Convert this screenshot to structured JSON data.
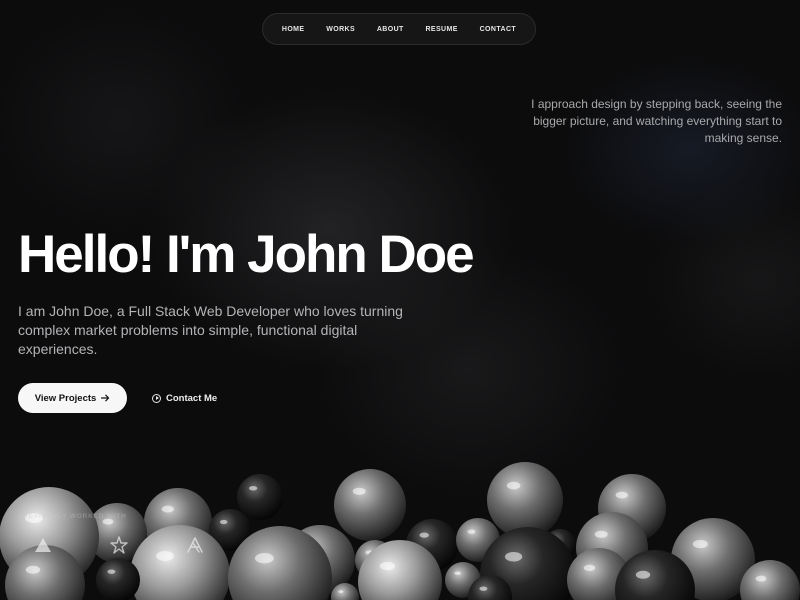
{
  "nav": {
    "items": [
      "HOME",
      "WORKS",
      "ABOUT",
      "RESUME",
      "CONTACT"
    ]
  },
  "tagline": "I approach design by stepping back, seeing the bigger picture, and watching everything start to making sense.",
  "hero": {
    "title": "Hello! I'm John Doe",
    "description": "I am John Doe, a Full Stack Web Developer who loves turning complex market problems into simple, functional digital experiences."
  },
  "buttons": {
    "primary_label": "View Projects",
    "primary_icon": "arrow-right-icon",
    "secondary_label": "Contact Me",
    "secondary_icon": "play-circle-icon"
  },
  "worked_with": {
    "label": "PREVIOUSLY WORKED WITH",
    "logos": [
      "triangle-logo-icon",
      "star-logo-icon",
      "a-logo-icon"
    ]
  },
  "colors": {
    "background": "#0c0c0d",
    "primary_button": "#f7f7f7",
    "text_muted": "#b4b4b7"
  }
}
